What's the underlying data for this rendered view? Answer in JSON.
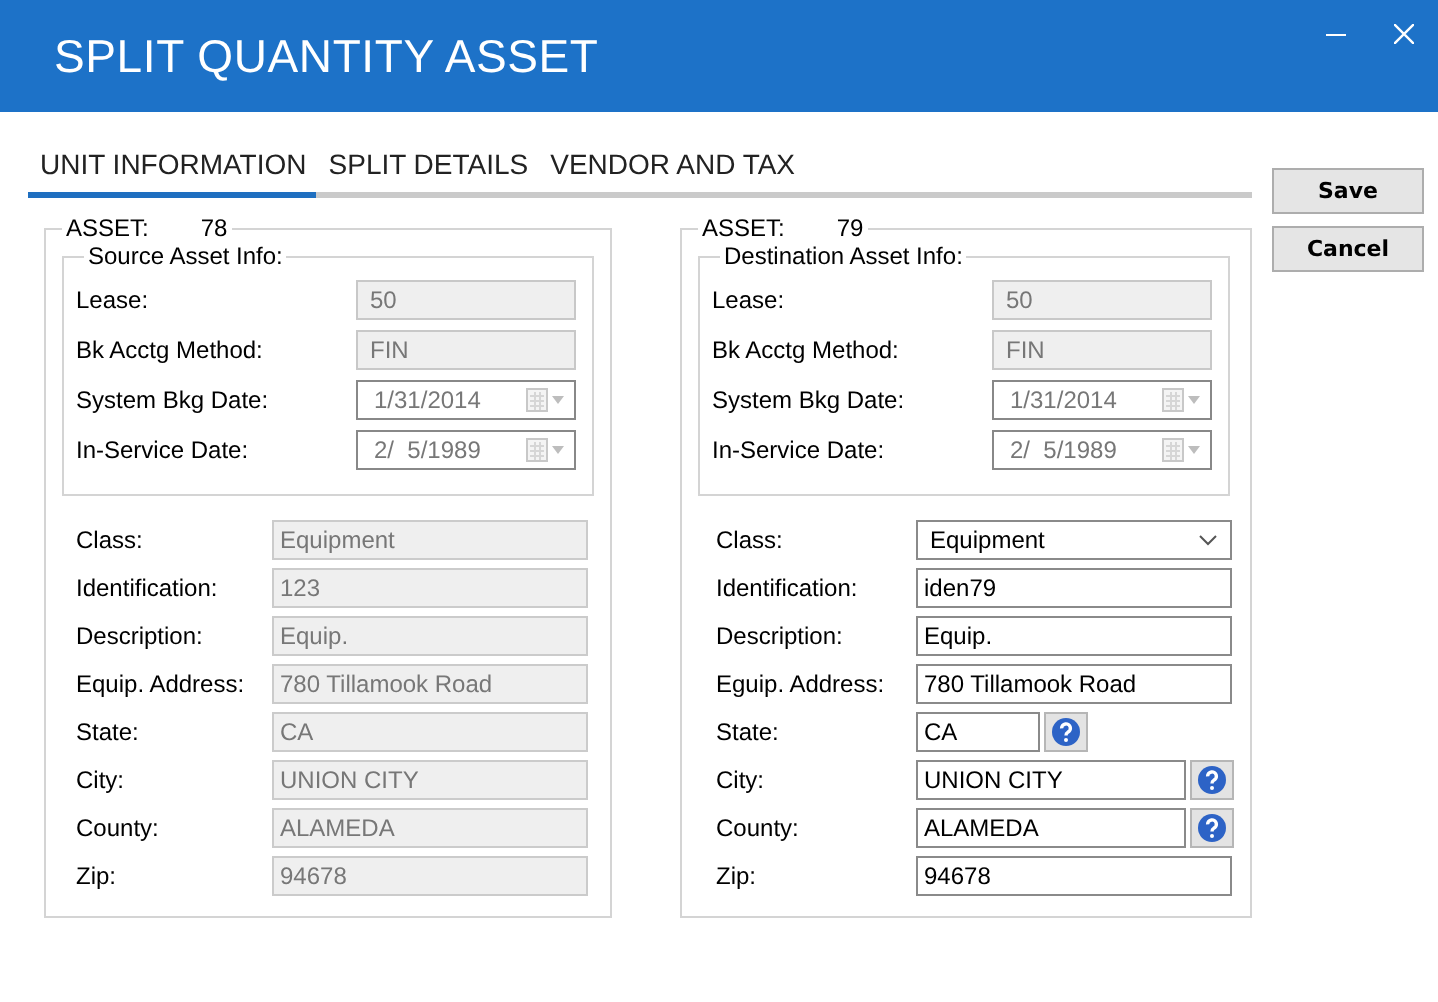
{
  "window": {
    "title": "SPLIT QUANTITY ASSET"
  },
  "tabs": [
    {
      "label": "UNIT INFORMATION",
      "selected": true
    },
    {
      "label": "SPLIT DETAILS",
      "selected": false
    },
    {
      "label": "VENDOR AND TAX",
      "selected": false
    }
  ],
  "buttons": [
    "Save",
    "Cancel"
  ],
  "panels": [
    {
      "asset_label": "ASSET:",
      "asset_number": "78",
      "info_title": "Source Asset Info:",
      "info_fields": [
        {
          "label": "Lease:",
          "value": "50",
          "kind": "text"
        },
        {
          "label": "Bk Acctg Method:",
          "value": "FIN",
          "kind": "text"
        },
        {
          "label": "System Bkg Date:",
          "value": "1/31/2014",
          "kind": "date"
        },
        {
          "label": "In-Service Date:",
          "value": "2/  5/1989",
          "kind": "date"
        }
      ],
      "fields": [
        {
          "label": "Class:",
          "value": "Equipment",
          "kind": "text",
          "disabled": true,
          "help": false
        },
        {
          "label": "Identification:",
          "value": "123",
          "kind": "text",
          "disabled": true,
          "help": false
        },
        {
          "label": "Description:",
          "value": "Equip.",
          "kind": "text",
          "disabled": true,
          "help": false
        },
        {
          "label": "Equip. Address:",
          "value": "780 Tillamook Road",
          "kind": "text",
          "disabled": true,
          "help": false
        },
        {
          "label": "State:",
          "value": "CA",
          "kind": "text",
          "disabled": true,
          "help": false
        },
        {
          "label": "City:",
          "value": "UNION CITY",
          "kind": "text",
          "disabled": true,
          "help": false
        },
        {
          "label": "County:",
          "value": "ALAMEDA",
          "kind": "text",
          "disabled": true,
          "help": false
        },
        {
          "label": "Zip:",
          "value": "94678",
          "kind": "text",
          "disabled": true,
          "help": false
        }
      ]
    },
    {
      "asset_label": "ASSET:",
      "asset_number": "79",
      "info_title": "Destination Asset Info:",
      "info_fields": [
        {
          "label": "Lease:",
          "value": "50",
          "kind": "text"
        },
        {
          "label": "Bk Acctg Method:",
          "value": "FIN",
          "kind": "text"
        },
        {
          "label": "System Bkg Date:",
          "value": "1/31/2014",
          "kind": "date"
        },
        {
          "label": "In-Service Date:",
          "value": "2/  5/1989",
          "kind": "date"
        }
      ],
      "fields": [
        {
          "label": "Class:",
          "value": "Equipment",
          "kind": "combo",
          "disabled": false,
          "help": false
        },
        {
          "label": "Identification:",
          "value": "iden79",
          "kind": "text",
          "disabled": false,
          "help": false
        },
        {
          "label": "Description:",
          "value": "Equip.",
          "kind": "text",
          "disabled": false,
          "help": false
        },
        {
          "label": "Eguip. Address:",
          "value": "780 Tillamook Road",
          "kind": "text",
          "disabled": false,
          "help": false
        },
        {
          "label": "State:",
          "value": "CA",
          "kind": "code",
          "disabled": false,
          "help": true
        },
        {
          "label": "City:",
          "value": "UNION CITY",
          "kind": "text",
          "disabled": false,
          "help": true
        },
        {
          "label": "County:",
          "value": "ALAMEDA",
          "kind": "text",
          "disabled": false,
          "help": true
        },
        {
          "label": "Zip:",
          "value": "94678",
          "kind": "text",
          "disabled": false,
          "help": false
        }
      ]
    }
  ]
}
